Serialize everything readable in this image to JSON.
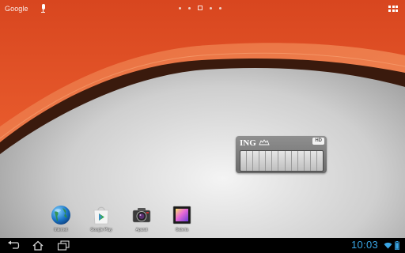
{
  "topbar": {
    "google_label": "Google",
    "page_count": 5,
    "active_page_index": 2
  },
  "widget": {
    "brand": "ING",
    "badge": "HD"
  },
  "home_icons": [
    {
      "label": "Internet",
      "icon": "globe-icon"
    },
    {
      "label": "Google Play",
      "icon": "play-store-icon"
    },
    {
      "label": "Aparat",
      "icon": "camera-icon"
    },
    {
      "label": "Galeria",
      "icon": "gallery-icon"
    }
  ],
  "navbar": {
    "clock": "10:03"
  },
  "colors": {
    "wallpaper_orange": "#e0502a",
    "clock_blue": "#3aa6e6"
  }
}
